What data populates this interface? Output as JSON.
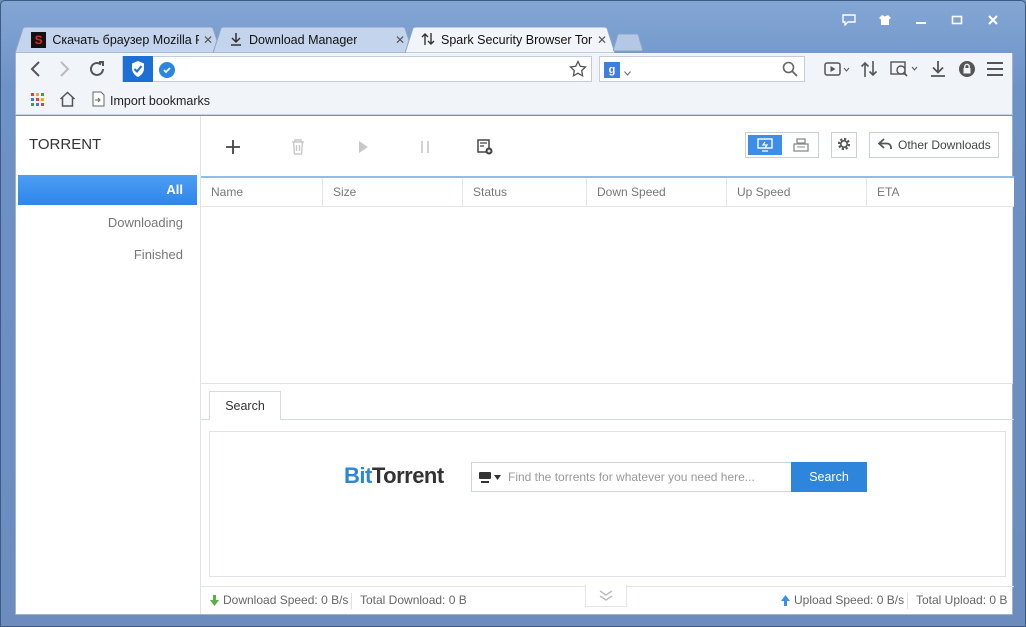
{
  "browser": {
    "tabs": [
      {
        "label": "Скачать браузер Mozilla Fi",
        "icon": "yandex-s-icon"
      },
      {
        "label": "Download Manager",
        "icon": "download-icon"
      },
      {
        "label": "Spark Security Browser Torr",
        "icon": "torrent-arrows-icon"
      }
    ],
    "bookmarks": {
      "import_label": "Import bookmarks"
    }
  },
  "sidebar": {
    "title": "TORRENT",
    "items": [
      {
        "label": "All"
      },
      {
        "label": "Downloading"
      },
      {
        "label": "Finished"
      }
    ]
  },
  "toolbar": {
    "other_downloads_label": "Other Downloads"
  },
  "table": {
    "columns": [
      "Name",
      "Size",
      "Status",
      "Down Speed",
      "Up Speed",
      "ETA"
    ]
  },
  "search": {
    "tab_label": "Search",
    "logo_bit": "Bit",
    "logo_torrent": "Torrent",
    "placeholder": "Find the torrents for whatever you need here...",
    "button_label": "Search"
  },
  "status": {
    "download_speed": "Download Speed: 0 B/s",
    "total_download": "Total Download: 0 B",
    "upload_speed": "Upload Speed: 0 B/s",
    "total_upload": "Total Upload: 0 B"
  },
  "colors": {
    "accent": "#2f86ea",
    "frame": "#6d92c6",
    "brand_bit": "#2c86d8"
  }
}
